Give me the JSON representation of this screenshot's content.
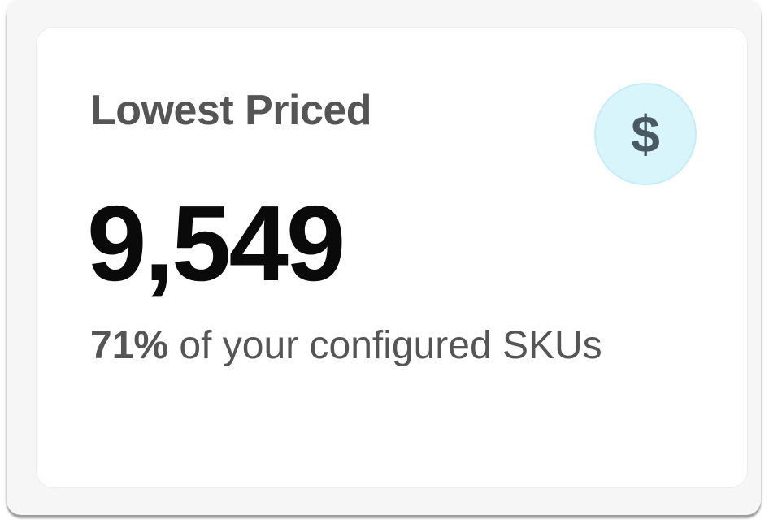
{
  "card": {
    "title": "Lowest Priced",
    "icon": "dollar-icon",
    "icon_glyph": "$",
    "metric_value": "9,549",
    "subtext_percent": "71%",
    "subtext_rest": " of your configured SKUs",
    "icon_background_color": "#d9f5fc"
  }
}
